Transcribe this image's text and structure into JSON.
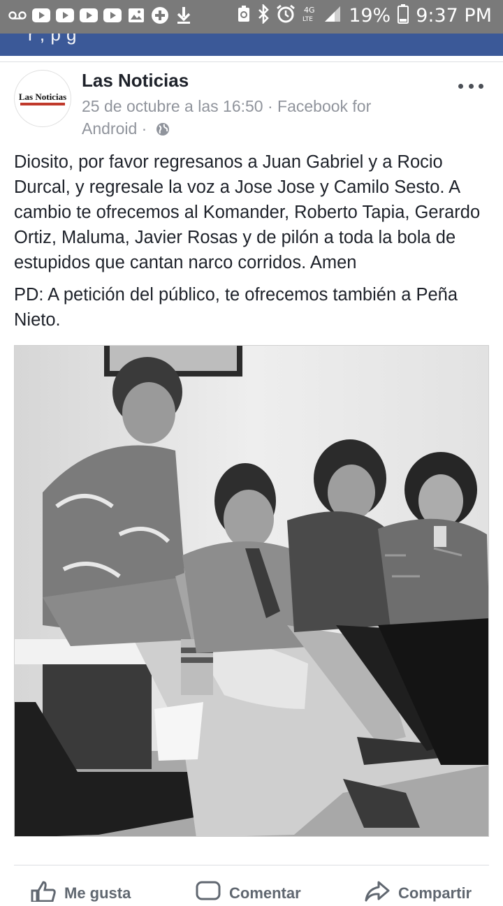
{
  "status_bar": {
    "battery": "19%",
    "time": "9:37 PM",
    "left_icons": [
      "voicemail-icon",
      "youtube-icon",
      "youtube-icon",
      "youtube-icon",
      "youtube-icon",
      "image-icon",
      "add-circle-icon",
      "download-icon"
    ],
    "right_icons": [
      "recycle-icon",
      "bluetooth-icon",
      "alarm-icon",
      "lte-icon",
      "signal-icon",
      "battery-icon"
    ]
  },
  "header": {
    "partial_text": "r , p        g"
  },
  "post": {
    "author": "Las Noticias",
    "avatar_text": "Las Noticias",
    "meta_line": "25 de octubre a las 16:50 · Facebook for Android ·",
    "privacy_icon": "globe-icon",
    "more_icon": "more-icon",
    "paragraphs": [
      "Diosito, por favor regresanos a Juan Gabriel y a Rocio Durcal, y regresale la voz a Jose Jose y Camilo Sesto. A cambio te ofrecemos al Komander, Roberto Tapia, Gerardo Ortiz, Maluma, Javier Rosas y de pilón a toda la bola de estupidos que cantan narco corridos. Amen",
      "PD: A petición del público, te ofrecemos también a Peña Nieto."
    ]
  },
  "actions": {
    "like": "Me gusta",
    "comment": "Comentar",
    "share": "Compartir"
  },
  "colors": {
    "facebook_blue": "#3b5998",
    "status_bar": "#7a7a7a",
    "meta_gray": "#90949c",
    "text": "#1d2129"
  }
}
